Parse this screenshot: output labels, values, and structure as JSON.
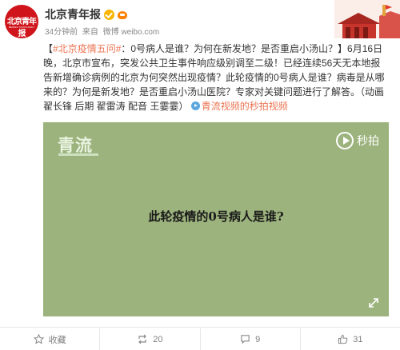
{
  "header": {
    "account_name": "北京青年报",
    "avatar_label": "北京青年报",
    "avatar_sub": "BEIJING YOUTH DAILY",
    "time": "34分钟前",
    "source_prefix": "来自",
    "source": "微博 weibo.com"
  },
  "post": {
    "hashtag": "#北京疫情五问#",
    "text_1": "：0号病人是谁？为何在新发地？是否重启小汤山？】6月16日晚，北京市宣布，突发公共卫生事件响应级别调至二级！已经连续56天无本地报告新增确诊病例的北京为何突然出现疫情？此轮疫情的0号病人是谁？病毒是从哪来的？为何是新发地？是否重启小汤山医院？专家对关键问题进行了解答。（动画 翟长锋 后期 翟雷涛 配音 王霎霎）",
    "bracket_open": "【",
    "video_link": "青流视频的秒拍视频"
  },
  "video": {
    "logo": "青流",
    "platform": "秒拍",
    "caption": "此轮疫情的0号病人是谁?",
    "bg_color": "#9cb37d"
  },
  "actions": {
    "favorite": "收藏",
    "repost_count": "20",
    "comment_count": "9",
    "like_count": "31"
  },
  "colors": {
    "accent": "#eb7350",
    "brand_red": "#d0141b",
    "verified": "#f7b500"
  }
}
